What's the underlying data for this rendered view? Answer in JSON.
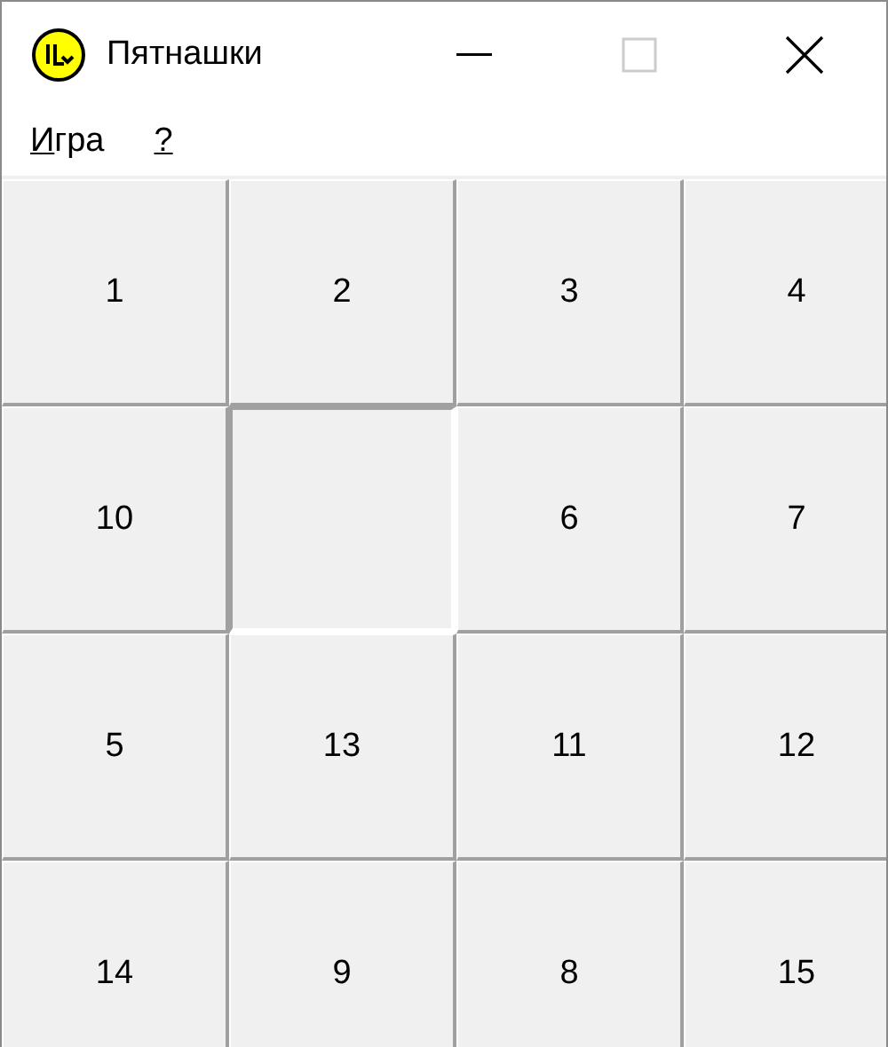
{
  "window": {
    "title": "Пятнашки",
    "controls": [
      {
        "kind": "minimize",
        "disabled": false
      },
      {
        "kind": "maximize",
        "disabled": true
      },
      {
        "kind": "close",
        "disabled": false
      }
    ]
  },
  "menu": [
    {
      "accel": "И",
      "rest": "гра"
    },
    {
      "accel": "?"
    }
  ],
  "board": {
    "tiles": [
      {
        "kind": "tile",
        "label": "1"
      },
      {
        "kind": "tile",
        "label": "2"
      },
      {
        "kind": "tile",
        "label": "3"
      },
      {
        "kind": "tile",
        "label": "4"
      },
      {
        "kind": "tile",
        "label": "10"
      },
      {
        "kind": "empty"
      },
      {
        "kind": "tile",
        "label": "6"
      },
      {
        "kind": "tile",
        "label": "7"
      },
      {
        "kind": "tile",
        "label": "5"
      },
      {
        "kind": "tile",
        "label": "13"
      },
      {
        "kind": "tile",
        "label": "11"
      },
      {
        "kind": "tile",
        "label": "12"
      },
      {
        "kind": "tile",
        "label": "14"
      },
      {
        "kind": "tile",
        "label": "9"
      },
      {
        "kind": "tile",
        "label": "8"
      },
      {
        "kind": "tile",
        "label": "15"
      }
    ]
  }
}
